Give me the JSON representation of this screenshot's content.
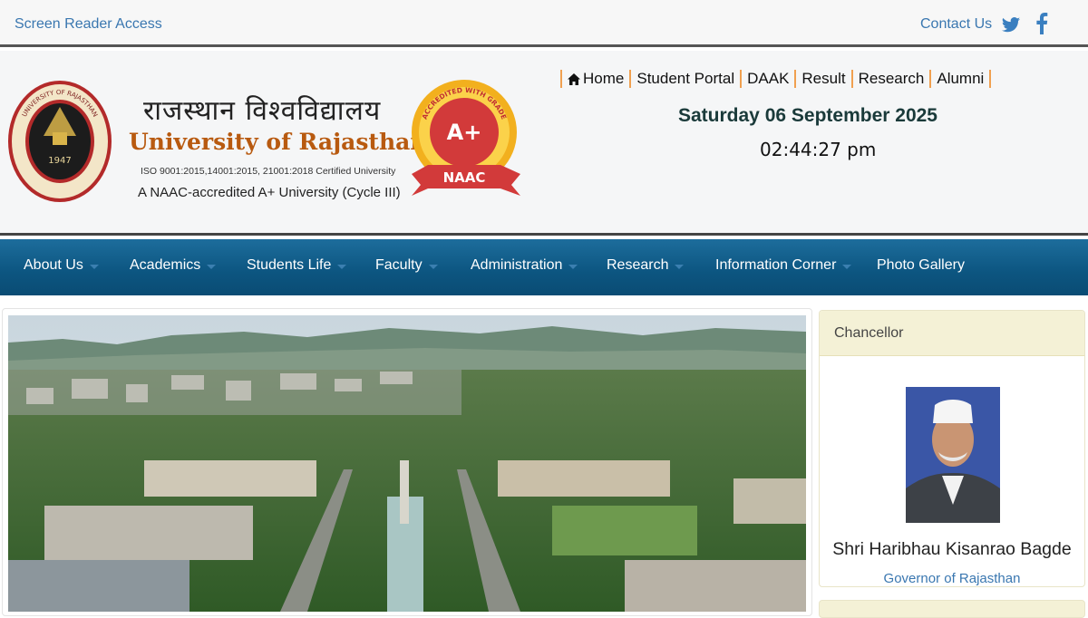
{
  "topbar": {
    "screen_reader": "Screen Reader Access",
    "contact": "Contact Us",
    "social": [
      "twitter-icon",
      "facebook-icon"
    ]
  },
  "header": {
    "seal_text": "UNIVERSITY OF RAJASTHAN",
    "seal_year": "1947",
    "hindi_name": "राजस्थान विश्वविद्यालय",
    "english_name": "University of Rajasthan",
    "iso": "ISO 9001:2015,14001:2015, 21001:2018 Certified University",
    "naac_line": "A NAAC-accredited A+ University (Cycle III)",
    "badge": {
      "grade": "A+",
      "label": "NAAC",
      "ring_text": "ACCREDITED WITH GRADE"
    },
    "top_links": [
      "Home",
      "Student Portal",
      "DAAK",
      "Result",
      "Research",
      "Alumni"
    ],
    "date": "Saturday 06 September 2025",
    "time": "02:44:27 pm"
  },
  "nav": {
    "items": [
      {
        "label": "About Us",
        "dropdown": true
      },
      {
        "label": "Academics",
        "dropdown": true
      },
      {
        "label": "Students Life",
        "dropdown": true
      },
      {
        "label": "Faculty",
        "dropdown": true
      },
      {
        "label": "Administration",
        "dropdown": true
      },
      {
        "label": "Research",
        "dropdown": true
      },
      {
        "label": "Information Corner",
        "dropdown": true
      },
      {
        "label": "Photo Gallery",
        "dropdown": false
      }
    ]
  },
  "chancellor": {
    "heading": "Chancellor",
    "name": "Shri Haribhau Kisanrao Bagde",
    "title": "Governor of Rajasthan"
  },
  "colors": {
    "link_blue": "#3a77b0",
    "nav_blue": "#0c5580",
    "brand_orange": "#b85a10",
    "badge_red": "#d23a3a",
    "badge_gold": "#f2b01e",
    "panel_header": "#f4f1d6"
  }
}
